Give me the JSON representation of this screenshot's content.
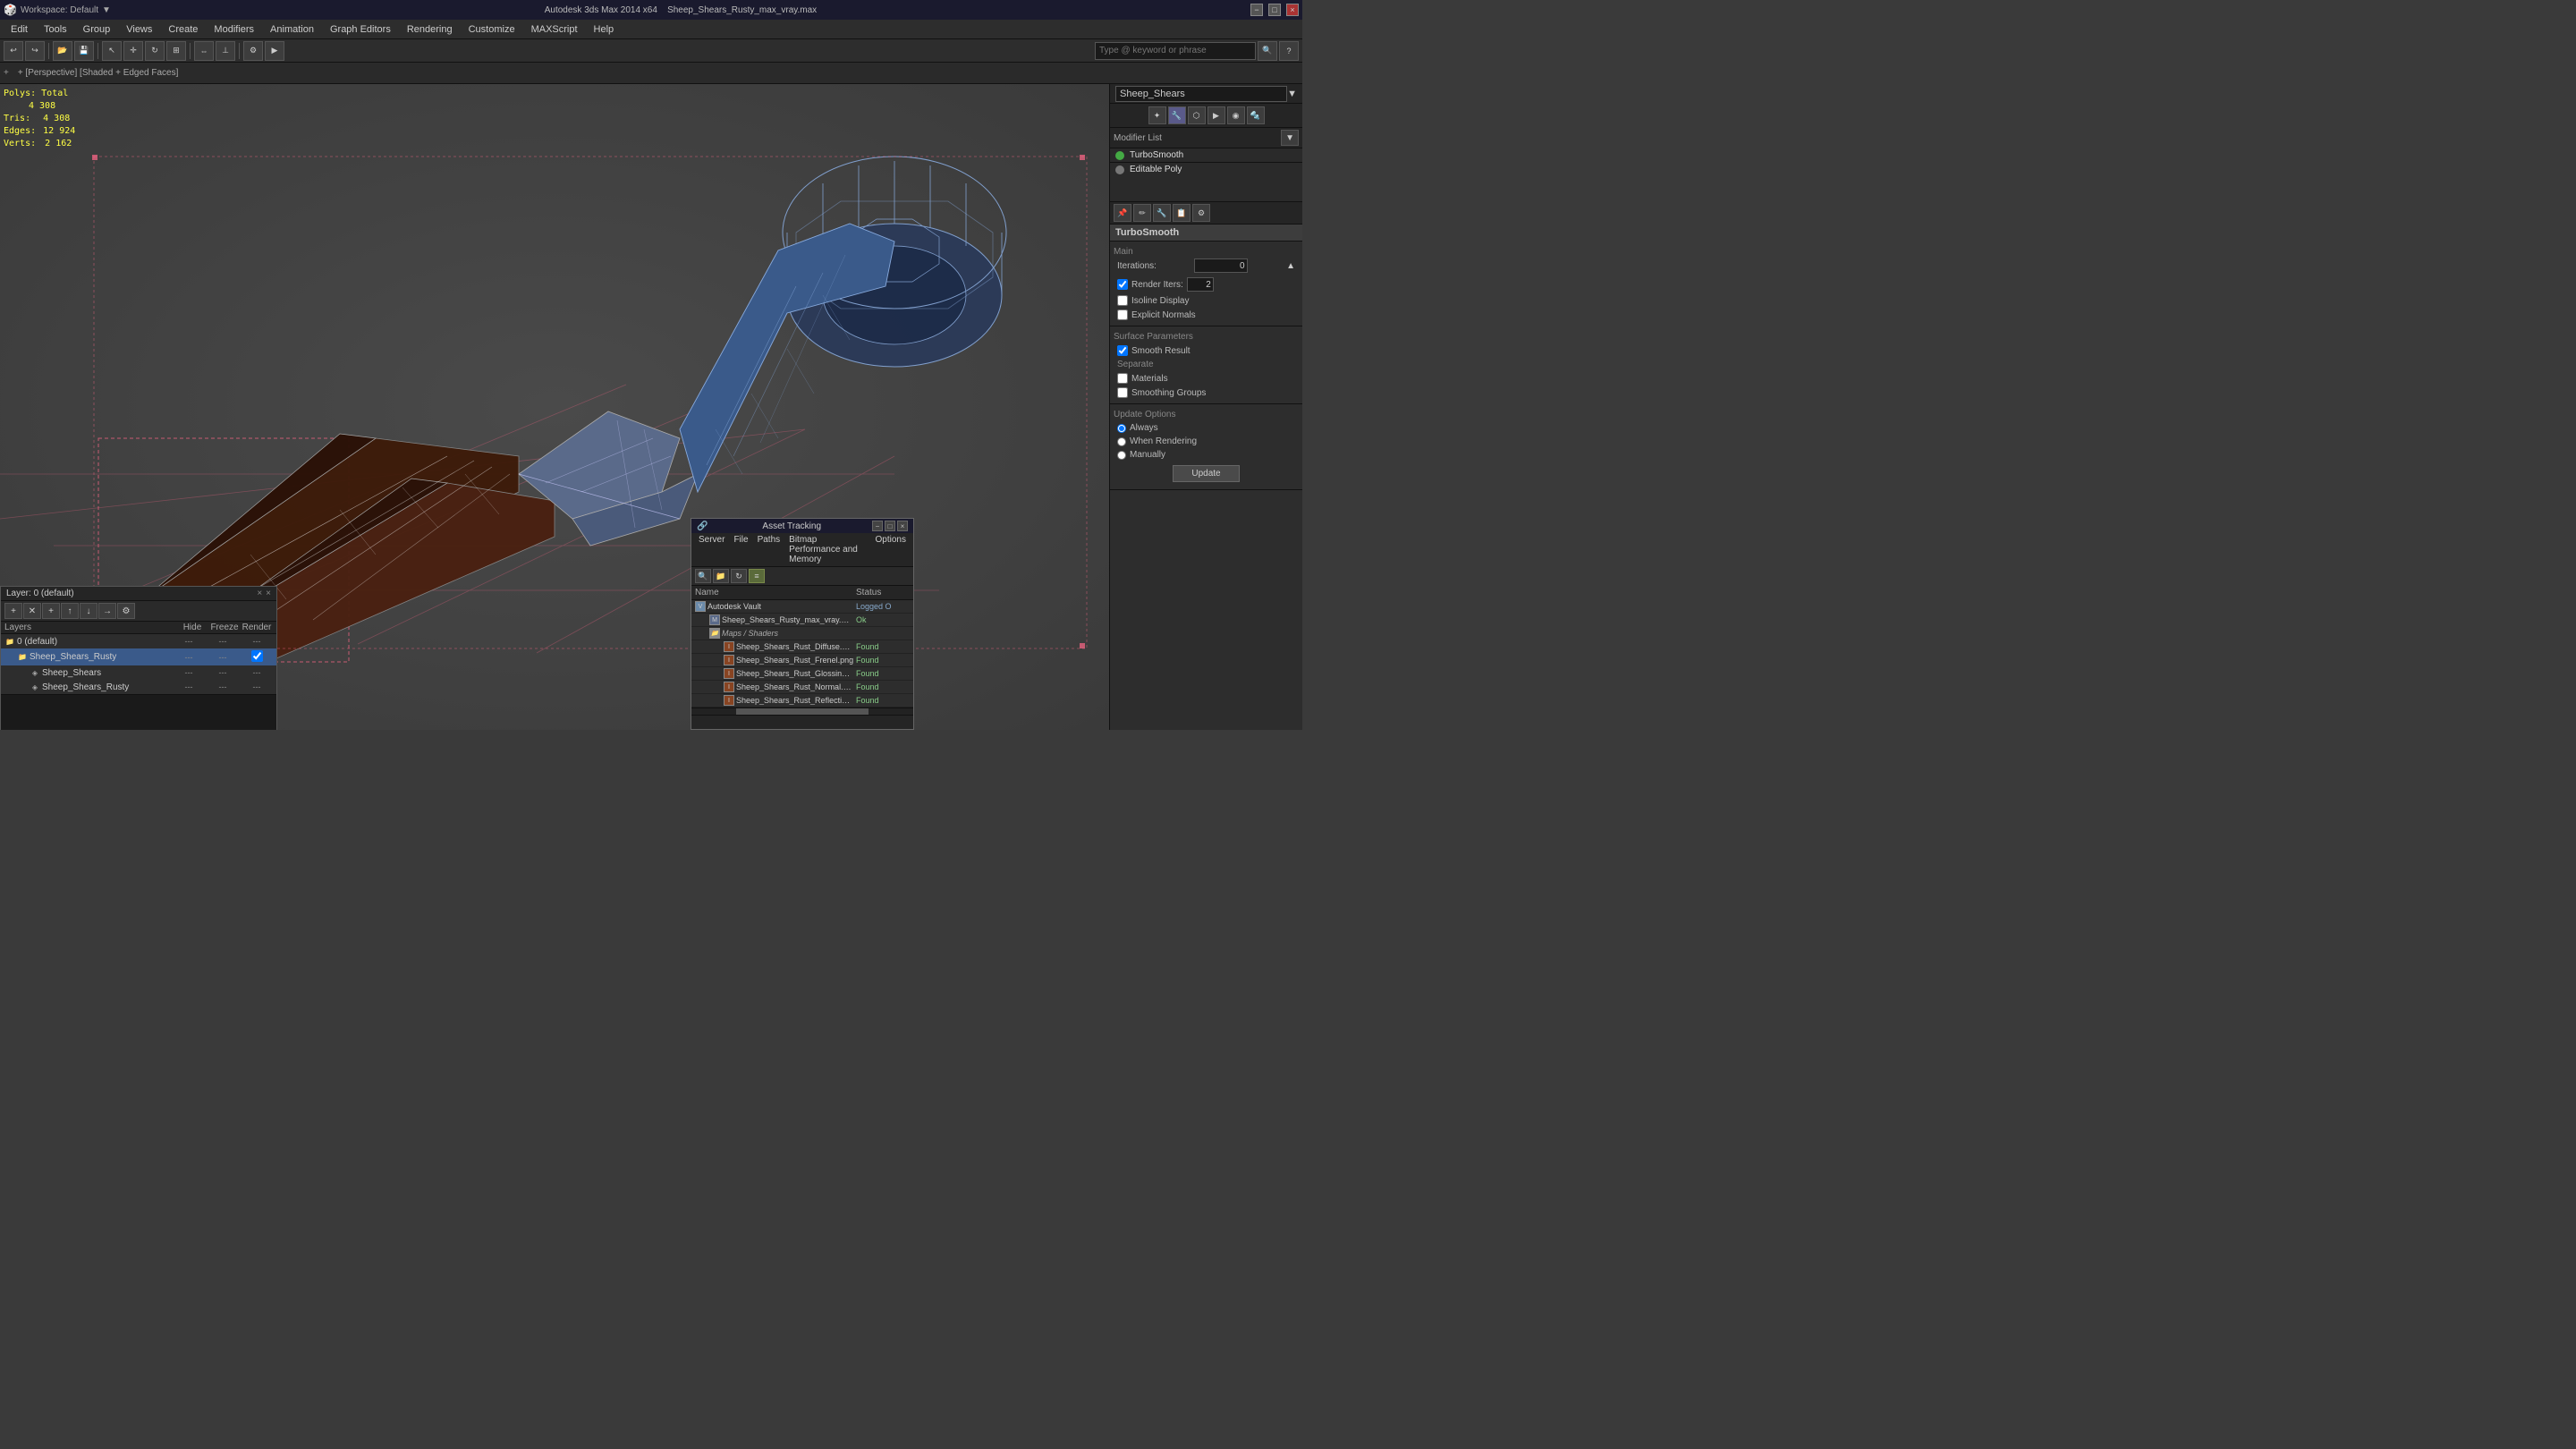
{
  "titlebar": {
    "app_icon": "3ds-max-icon",
    "title": "Sheep_Shears_Rusty_max_vray.max",
    "subtitle": "Autodesk 3ds Max 2014 x64",
    "workspace_label": "Workspace: Default",
    "minimize_label": "−",
    "maximize_label": "□",
    "close_label": "×"
  },
  "menu": {
    "items": [
      "Edit",
      "Tools",
      "Group",
      "Views",
      "Create",
      "Modifiers",
      "Animation",
      "Graph Editors",
      "Rendering",
      "Customize",
      "MAXScript",
      "Help"
    ]
  },
  "toolbar": {
    "workspace_value": "Workspace: Default",
    "search_placeholder": "Type @ keyword or phrase",
    "buttons": [
      "↩",
      "↪",
      "📁",
      "💾",
      "✂",
      "📋",
      "🔍"
    ]
  },
  "viewport": {
    "label": "+ [Perspective] [Shaded + Edged Faces]",
    "stats": {
      "polys_label": "Polys:",
      "polys_total": "Total",
      "polys_value": "4 308",
      "tris_label": "Tris:",
      "tris_value": "4 308",
      "edges_label": "Edges:",
      "edges_value": "12 924",
      "verts_label": "Verts:",
      "verts_value": "2 162"
    }
  },
  "right_panel": {
    "object_name": "Sheep_Shears",
    "modifier_list_label": "Modifier List",
    "dropdown_arrow": "▼",
    "modifiers": [
      {
        "name": "TurboSmooth",
        "active": false,
        "dot_color": "green"
      },
      {
        "name": "Editable Poly",
        "active": false,
        "dot_color": "default"
      }
    ],
    "turbosmooth_section": "TurboSmooth",
    "main_label": "Main",
    "iterations_label": "Iterations:",
    "iterations_value": "0",
    "render_iters_label": "Render Iters:",
    "render_iters_value": "2",
    "isoline_display_label": "Isoline Display",
    "explicit_normals_label": "Explicit Normals",
    "surface_params_label": "Surface Parameters",
    "smooth_result_label": "Smooth Result",
    "smooth_result_checked": true,
    "separate_label": "Separate",
    "materials_label": "Materials",
    "smoothing_groups_label": "Smoothing Groups",
    "update_options_label": "Update Options",
    "always_label": "Always",
    "when_rendering_label": "When Rendering",
    "manually_label": "Manually",
    "update_btn_label": "Update",
    "panel_icons": [
      "▶",
      "✏",
      "🔧",
      "📋",
      "⚙"
    ]
  },
  "layer_panel": {
    "title": "Layer: 0 (default)",
    "close_label": "×",
    "question_label": "?",
    "columns": {
      "name": "Layers",
      "hide": "Hide",
      "freeze": "Freeze",
      "render": "Render"
    },
    "layers": [
      {
        "name": "0 (default)",
        "indent": 0,
        "selected": false
      },
      {
        "name": "Sheep_Shears_Rusty",
        "indent": 1,
        "selected": true
      },
      {
        "name": "Sheep_Shears",
        "indent": 2,
        "selected": false
      },
      {
        "name": "Sheep_Shears_Rusty",
        "indent": 2,
        "selected": false
      }
    ]
  },
  "asset_panel": {
    "title": "Asset Tracking",
    "menus": [
      "Server",
      "File",
      "Paths",
      "Bitmap Performance and Memory",
      "Options"
    ],
    "table_headers": {
      "name": "Name",
      "status": "Status"
    },
    "items": [
      {
        "name": "Autodesk Vault",
        "status": "Logged O",
        "indent": 0,
        "type": "vault"
      },
      {
        "name": "Sheep_Shears_Rusty_max_vray.max",
        "status": "Ok",
        "indent": 1,
        "type": "file"
      },
      {
        "name": "Maps / Shaders",
        "status": "",
        "indent": 1,
        "type": "folder"
      },
      {
        "name": "Sheep_Shears_Rust_Diffuse.png",
        "status": "Found",
        "indent": 2,
        "type": "image"
      },
      {
        "name": "Sheep_Shears_Rust_Frenel.png",
        "status": "Found",
        "indent": 2,
        "type": "image"
      },
      {
        "name": "Sheep_Shears_Rust_Glossiness.png",
        "status": "Found",
        "indent": 2,
        "type": "image"
      },
      {
        "name": "Sheep_Shears_Rust_Normal.png",
        "status": "Found",
        "indent": 2,
        "type": "image"
      },
      {
        "name": "Sheep_Shears_Rust_Reflection.png",
        "status": "Found",
        "indent": 2,
        "type": "image"
      }
    ]
  }
}
